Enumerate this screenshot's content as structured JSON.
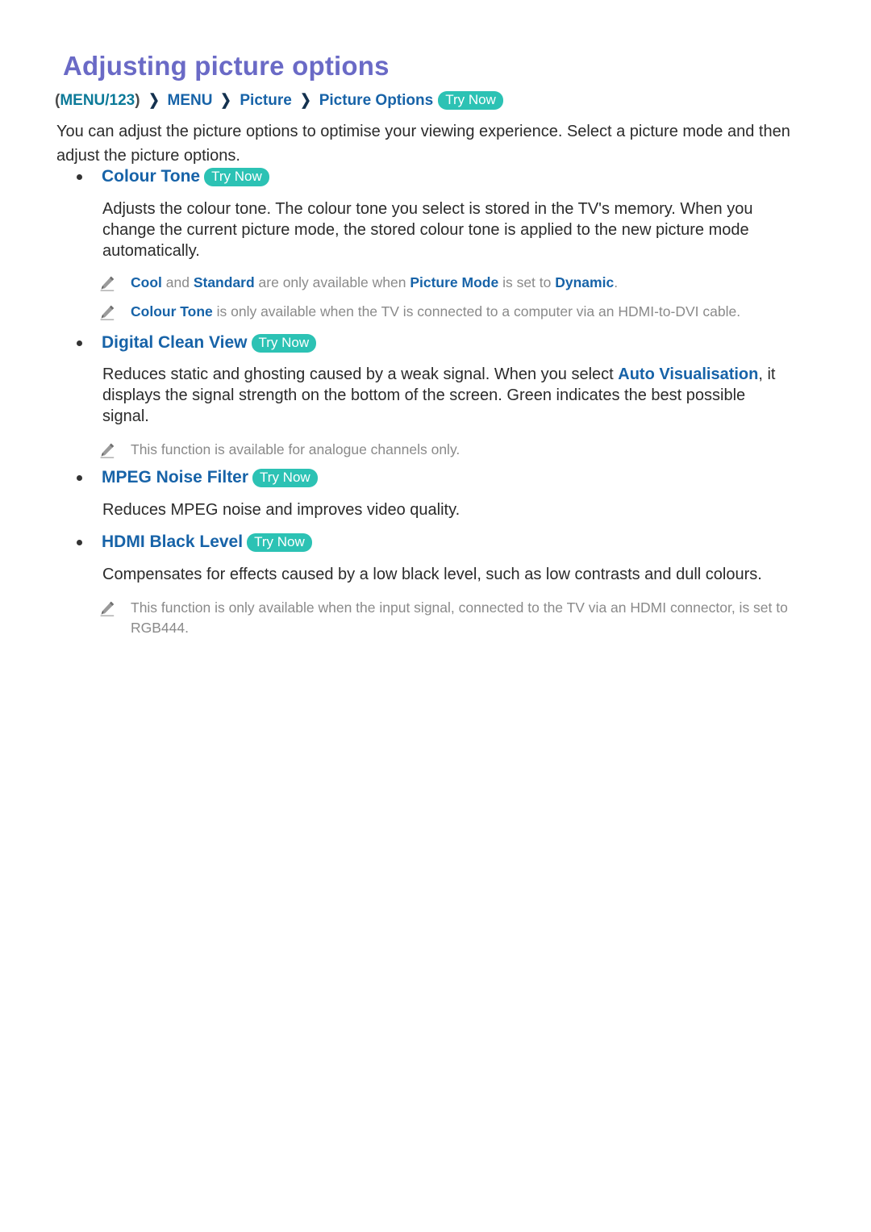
{
  "document": {
    "title": "Adjusting picture options",
    "colors": {
      "title": "#6a6ac6",
      "link_blue": "#1763a8",
      "menu_teal": "#0c7a99",
      "badge_teal": "#2cc2b4",
      "body": "#2b2b2b",
      "note_gray": "#8a8a8a",
      "background": "#ffffff"
    }
  },
  "breadcrumb": {
    "open_paren": "(",
    "menu123": "MENU/123",
    "close_paren": ")",
    "separator": "❯",
    "items": [
      "MENU",
      "Picture",
      "Picture Options"
    ],
    "try_now": "Try Now"
  },
  "intro": {
    "text": "You can adjust the picture options to optimise your viewing experience. Select a picture mode and then adjust the picture options."
  },
  "sections": [
    {
      "id": "colour-tone",
      "heading": "Colour Tone",
      "try_now": "Try Now",
      "body": "Adjusts the colour tone. The colour tone you select is stored in the TV's memory. When you change the current picture mode, the stored colour tone is applied to the new picture mode automatically.",
      "notes": [
        {
          "parts": [
            {
              "t": "Cool",
              "hl": true
            },
            {
              "t": " and ",
              "hl": false
            },
            {
              "t": "Standard",
              "hl": true
            },
            {
              "t": " are only available when ",
              "hl": false
            },
            {
              "t": "Picture Mode",
              "hl": true
            },
            {
              "t": " is set to ",
              "hl": false
            },
            {
              "t": "Dynamic",
              "hl": true
            },
            {
              "t": ".",
              "hl": false
            }
          ]
        },
        {
          "parts": [
            {
              "t": "Colour Tone",
              "hl": true
            },
            {
              "t": " is only available when the TV is connected to a computer via an HDMI-to-DVI cable.",
              "hl": false
            }
          ]
        }
      ]
    },
    {
      "id": "digital-clean-view",
      "heading": "Digital Clean View",
      "try_now": "Try Now",
      "body_parts": [
        {
          "t": "Reduces static and ghosting caused by a weak signal. When you select ",
          "hl": false
        },
        {
          "t": "Auto Visualisation",
          "hl": true
        },
        {
          "t": ", it displays the signal strength on the bottom of the screen. Green indicates the best possible signal.",
          "hl": false
        }
      ],
      "notes": [
        {
          "parts": [
            {
              "t": "This function is available for analogue channels only.",
              "hl": false
            }
          ]
        }
      ]
    },
    {
      "id": "mpeg-noise-filter",
      "heading": "MPEG Noise Filter",
      "try_now": "Try Now",
      "body": "Reduces MPEG noise and improves video quality.",
      "notes": []
    },
    {
      "id": "hdmi-black-level",
      "heading": "HDMI Black Level",
      "try_now": "Try Now",
      "body": "Compensates for effects caused by a low black level, such as low contrasts and dull colours.",
      "notes": [
        {
          "parts": [
            {
              "t": "This function is only available when the input signal, connected to the TV via an HDMI connector, is set to RGB444.",
              "hl": false
            }
          ]
        }
      ]
    }
  ],
  "icons": {
    "note": "pencil-icon",
    "bullet": "bullet-dot-icon",
    "separator": "chevron-right-icon"
  }
}
